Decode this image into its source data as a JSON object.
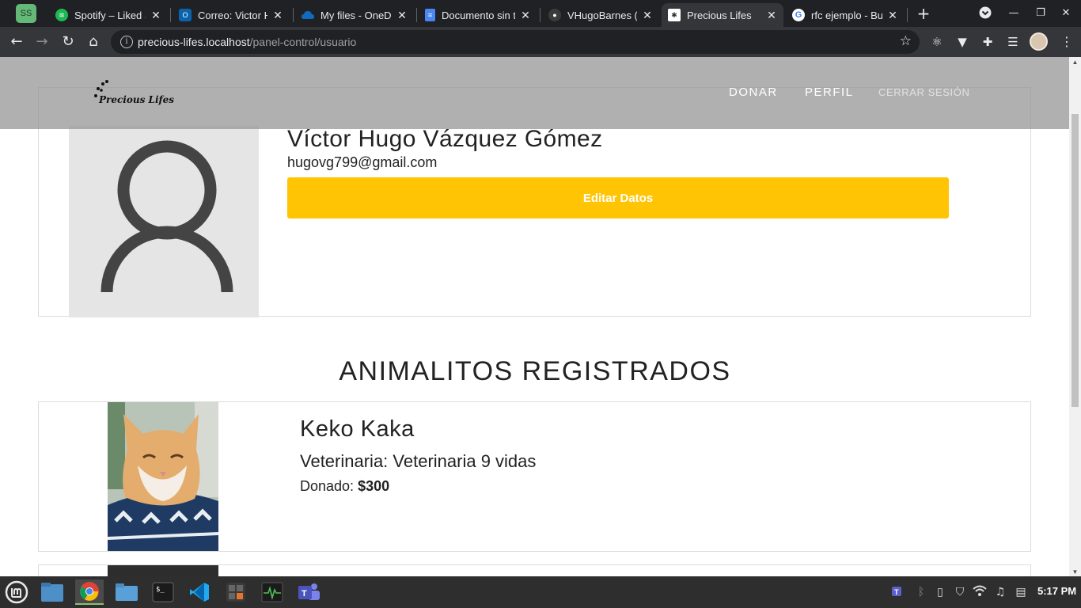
{
  "browser": {
    "profile_badge": "SS",
    "tabs": [
      {
        "title": "Spotify – Liked S",
        "icon": "spotify-icon",
        "color": "#1db954"
      },
      {
        "title": "Correo: Victor H",
        "icon": "outlook-icon",
        "color": "#0a64ad"
      },
      {
        "title": "My files - OneDr",
        "icon": "onedrive-icon",
        "color": "#0f6cbd"
      },
      {
        "title": "Documento sin t",
        "icon": "google-docs-icon",
        "color": "#4a86f6"
      },
      {
        "title": "VHugoBarnes (V",
        "icon": "github-icon",
        "color": "#ffffff"
      },
      {
        "title": "Precious Lifes",
        "icon": "paw-icon",
        "color": "#ffffff"
      },
      {
        "title": "rfc ejemplo - Bu",
        "icon": "google-icon",
        "color": "#4285f4"
      }
    ],
    "active_tab": 5,
    "address": {
      "host": "precious-lifes.localhost",
      "path": "/panel-control/usuario"
    }
  },
  "site": {
    "brand": "Precious Lifes",
    "nav": {
      "donate": "DONAR",
      "profile": "PERFIL",
      "logout": "CERRAR SESIÓN"
    }
  },
  "user": {
    "name": "Víctor Hugo Vázquez Gómez",
    "email": "hugovg799@gmail.com",
    "edit_label": "Editar Datos"
  },
  "pets_section": {
    "title": "ANIMALITOS REGISTRADOS",
    "pets": [
      {
        "name": "Keko Kaka",
        "vet_label": "Veterinaria: ",
        "vet_value": "Veterinaria 9 vidas",
        "donated_label": "Donado: ",
        "donated_value": "$300"
      }
    ]
  },
  "taskbar": {
    "clock": "5:17 PM",
    "apps": [
      "mint-menu-icon",
      "files-icon",
      "chrome-icon",
      "folder-icon",
      "terminal-icon",
      "vscode-icon",
      "calculator-icon",
      "system-monitor-icon",
      "teams-icon"
    ]
  },
  "colors": {
    "accent_button": "#ffc505",
    "nav_overlay": "#969696"
  }
}
